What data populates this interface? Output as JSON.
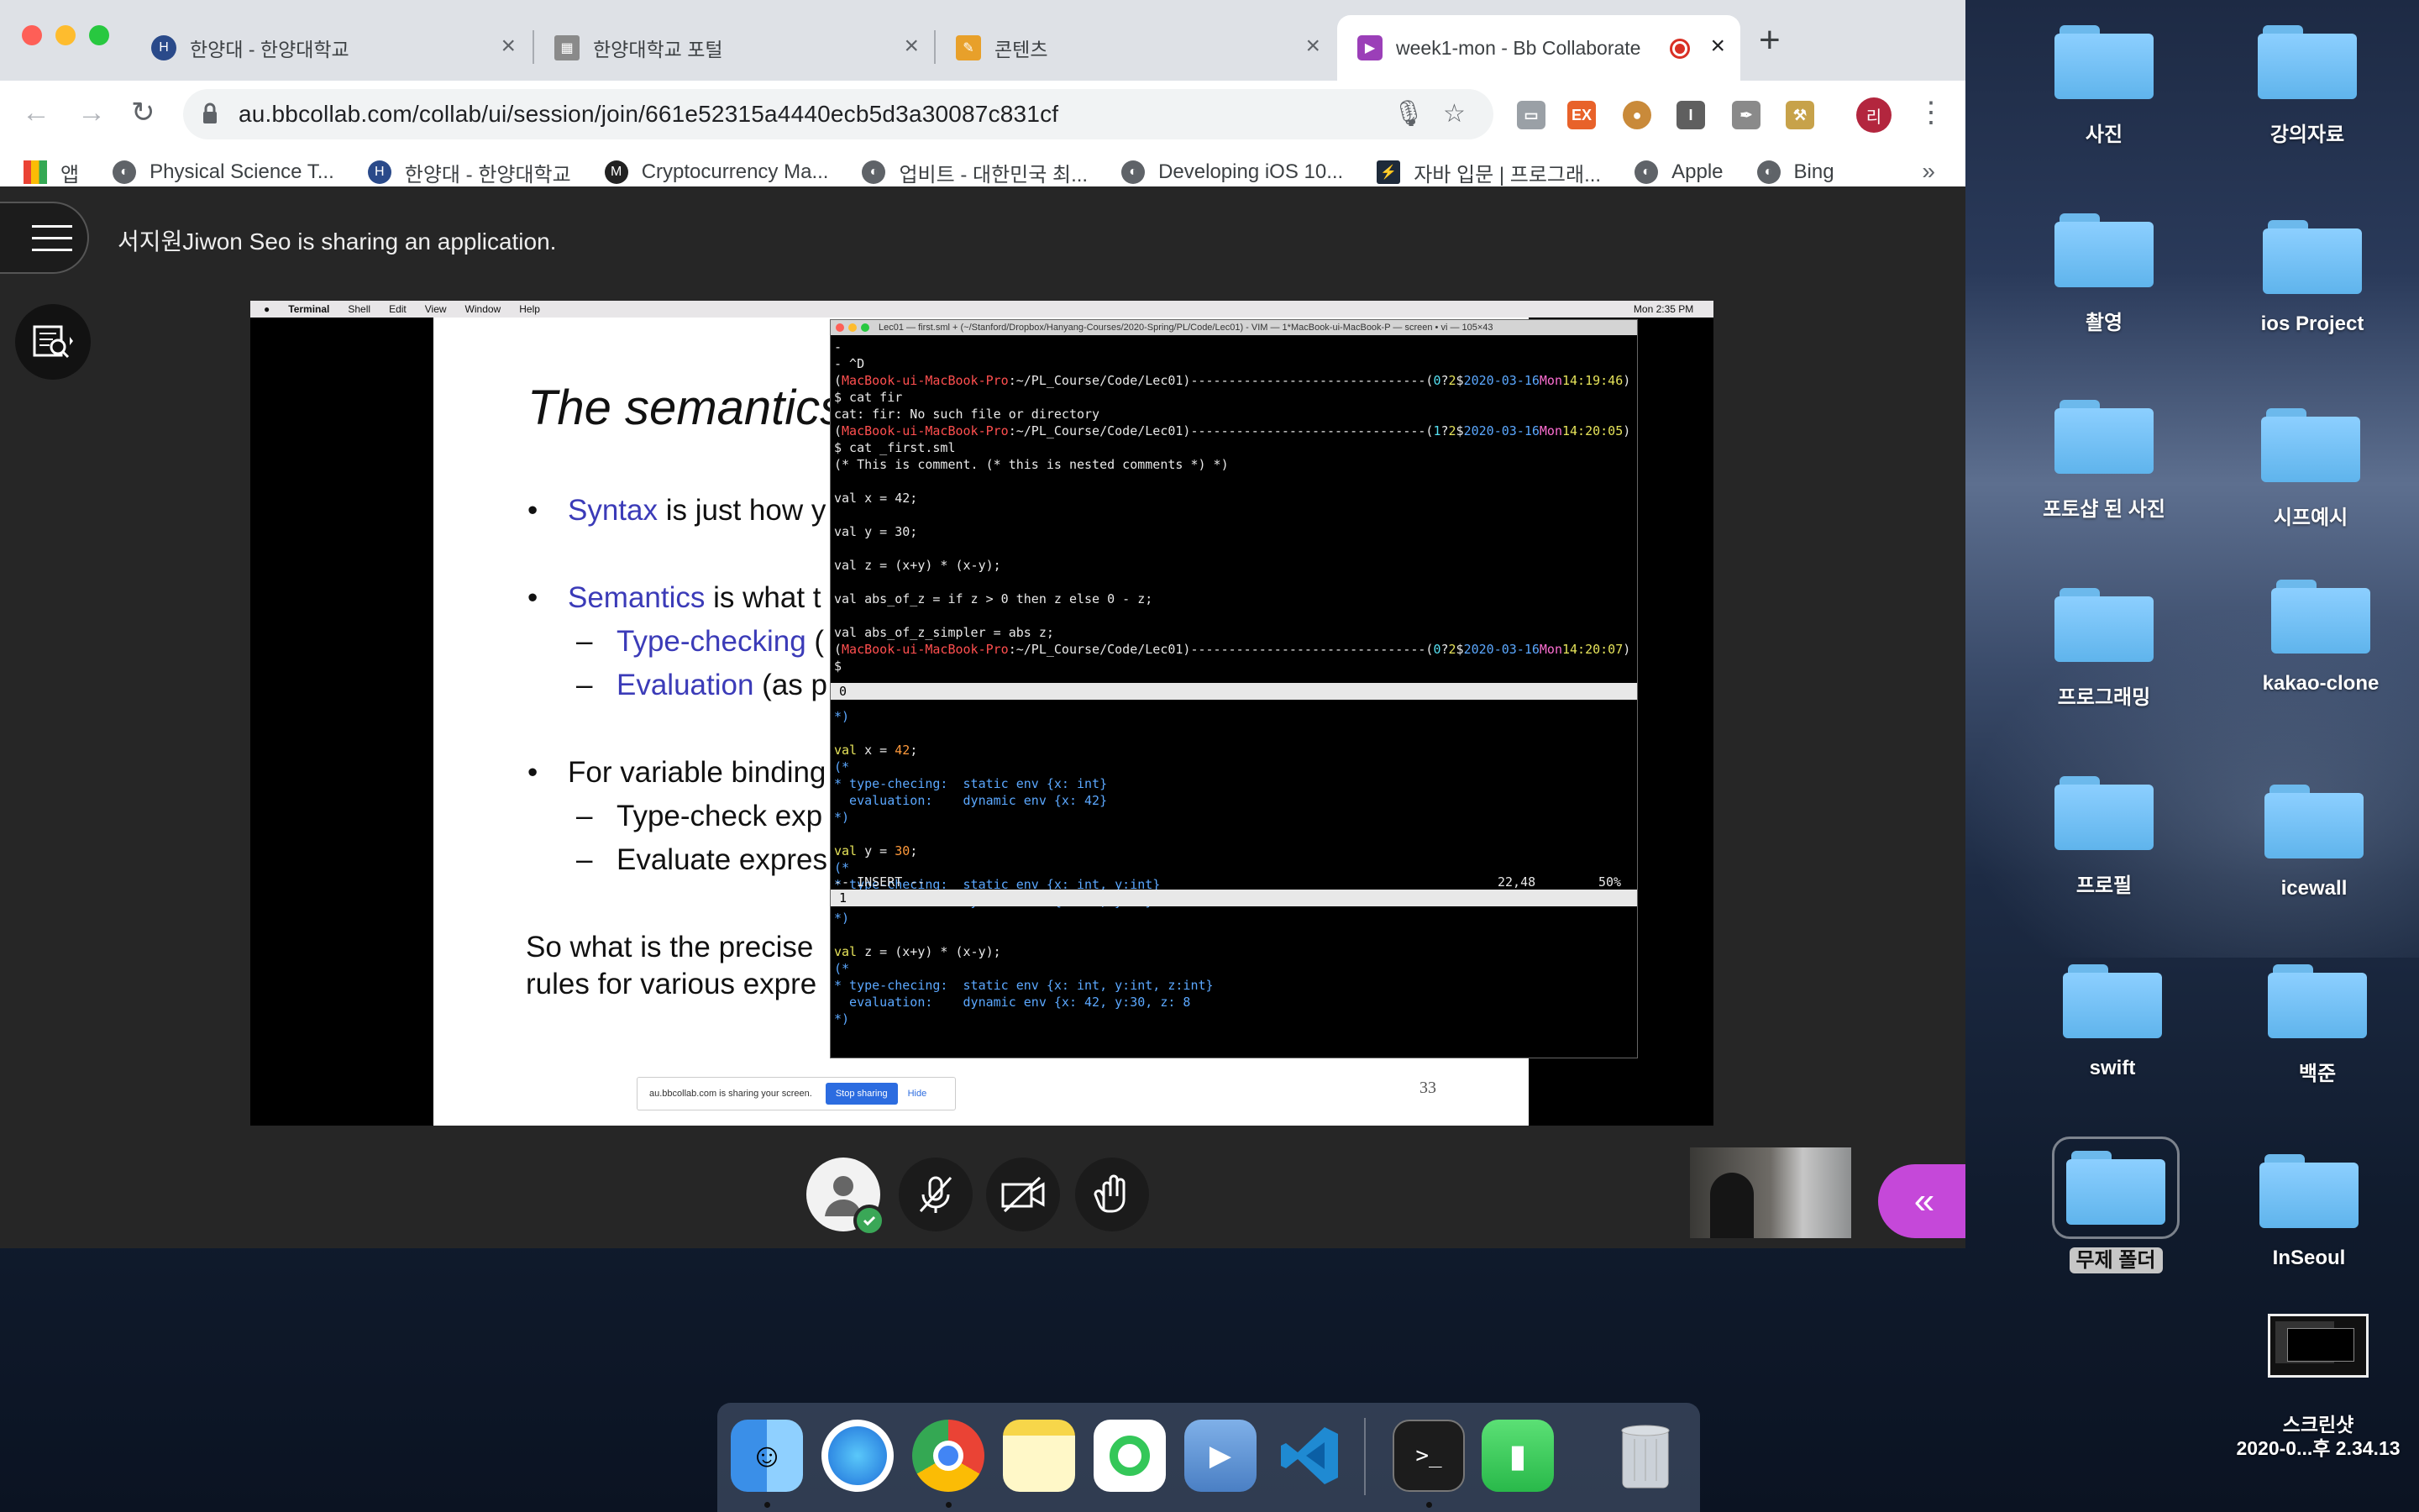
{
  "browser": {
    "tabs": [
      {
        "label": "한양대 - 한양대학교"
      },
      {
        "label": "한양대학교 포털"
      },
      {
        "label": "콘텐츠"
      },
      {
        "label": "week1-mon - Bb Collaborate"
      }
    ],
    "url": "au.bbcollab.com/collab/ui/session/join/661e52315a4440ecb5d3a30087c831cf",
    "bookmarks": [
      {
        "label": "앱"
      },
      {
        "label": "Physical Science T..."
      },
      {
        "label": "한양대 - 한양대학교"
      },
      {
        "label": "Cryptocurrency Ma..."
      },
      {
        "label": "업비트 - 대한민국 최..."
      },
      {
        "label": "Developing iOS 10..."
      },
      {
        "label": "자바 입문 | 프로그래..."
      },
      {
        "label": "Apple"
      },
      {
        "label": "Bing"
      }
    ],
    "more": "»",
    "profile_initial": "리"
  },
  "collab": {
    "share_notice": "서지원Jiwon Seo is sharing an application."
  },
  "shared_screen": {
    "mac_menu": [
      "Terminal",
      "Shell",
      "Edit",
      "View",
      "Window",
      "Help"
    ],
    "clock": "Mon 2:35 PM",
    "slide": {
      "title": "The semantics",
      "lines": [
        {
          "bullet": "•",
          "highlight": "Syntax",
          "text": " is just how y"
        },
        {
          "bullet": "•",
          "highlight": "Semantics",
          "text": " is what t"
        },
        {
          "bullet": "–",
          "highlight": "Type-checking",
          "text": " ("
        },
        {
          "bullet": "–",
          "highlight": "Evaluation",
          "text": " (as p"
        },
        {
          "bullet": "•",
          "highlight": "",
          "text": "For variable binding"
        },
        {
          "bullet": "–",
          "highlight": "",
          "text": "Type-check exp"
        },
        {
          "bullet": "–",
          "highlight": "",
          "text": "Evaluate expres"
        },
        {
          "bullet": "",
          "highlight": "",
          "text": "So what is the precise"
        },
        {
          "bullet": "",
          "highlight": "",
          "text": "rules for various expre"
        }
      ],
      "page_number": "33"
    },
    "share_bar": {
      "text": "au.bbcollab.com is sharing your screen.",
      "stop": "Stop sharing",
      "hide": "Hide"
    },
    "terminal": {
      "title": "Lec01 — first.sml + (~/Stanford/Dropbox/Hanyang-Courses/2020-Spring/PL/Code/Lec01) - VIM — 1*MacBook-ui-MacBook-P — screen • vi — 105×43",
      "mode": "-- INSERT --",
      "position": "22,48",
      "percent": "50%",
      "vim_line": "0",
      "bottom_line": "1"
    }
  },
  "desktop": {
    "icons": [
      "사진",
      "강의자료",
      "촬영",
      "ios Project",
      "포토샵 된 사진",
      "시프예시",
      "프로그래밍",
      "kakao-clone",
      "프로필",
      "icewall",
      "swift",
      "백준",
      "무제 폴더",
      "InSeoul"
    ],
    "screenshot": {
      "line1": "스크린샷",
      "line2": "2020-0...후 2.34.13"
    }
  }
}
